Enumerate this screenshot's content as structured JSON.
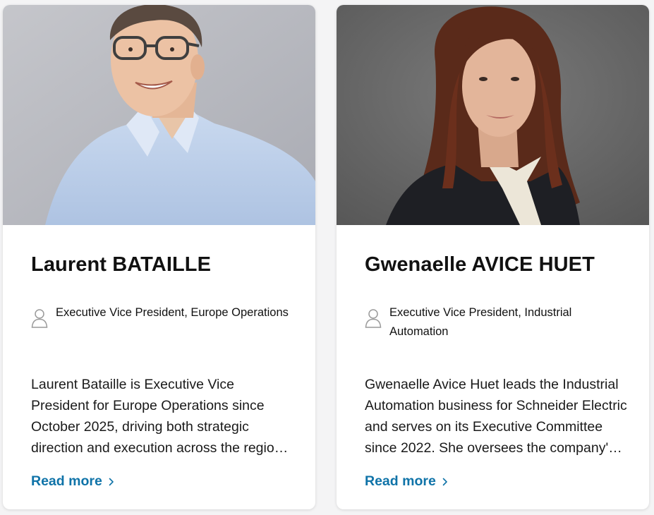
{
  "colors": {
    "link": "#0f73a8",
    "name_text": "#111111",
    "card_bg": "#ffffff",
    "page_bg": "#f4f4f5"
  },
  "people": [
    {
      "name": "Laurent BATAILLE",
      "role": "Executive Vice President, Europe Operations",
      "description": "Laurent Bataille is Executive Vice President for Europe Operations since October 2025, driving both strategic direction and execution across the region and its businesses.",
      "read_more": "Read more",
      "photo_icon": "portrait-photo"
    },
    {
      "name": "Gwenaelle AVICE HUET",
      "role": "Executive Vice President, Industrial Automation",
      "description": "Gwenaelle Avice Huet leads the Industrial Automation business for Schneider Electric and serves on its Executive Committee since 2022. She oversees the company's global automation activities.",
      "read_more": "Read more",
      "photo_icon": "portrait-photo"
    }
  ]
}
